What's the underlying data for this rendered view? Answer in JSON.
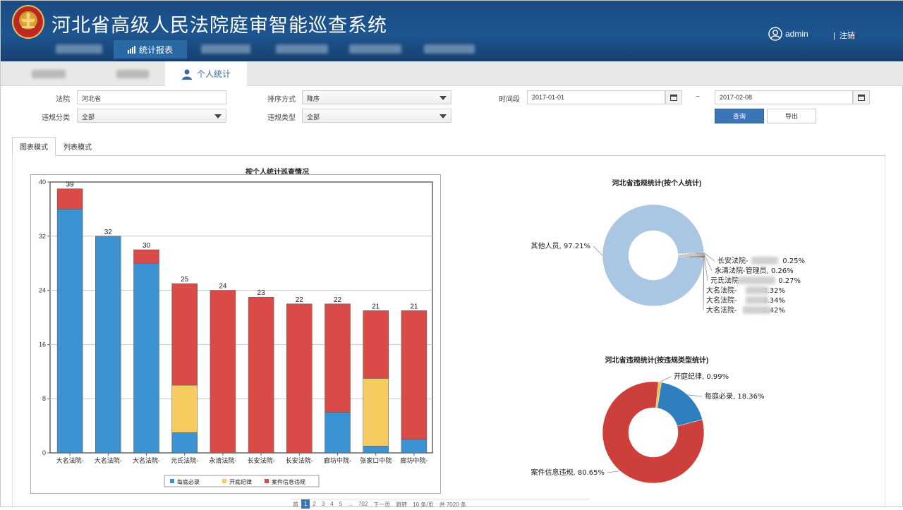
{
  "header": {
    "title": "河北省高级人民法院庭审智能巡查系统",
    "username": "admin",
    "logout_label": "注销",
    "logout_sep": "|",
    "active_nav": "统计报表"
  },
  "subtabs": {
    "active": "个人统计"
  },
  "filters": {
    "court_label": "法院",
    "court_value": "河北省",
    "sort_label": "排序方式",
    "sort_value": "降序",
    "period_label": "时间段",
    "date_from": "2017-01-01",
    "date_sep": "~",
    "date_to": "2017-02-08",
    "violation_cat_label": "违规分类",
    "violation_cat_value": "全部",
    "violation_type_label": "违规类型",
    "violation_type_value": "全部",
    "query_label": "查询",
    "export_label": "导出"
  },
  "view_tabs": {
    "chart": "图表模式",
    "list": "列表模式"
  },
  "chart_data": [
    {
      "type": "bar",
      "title": "按个人统计巡查情况",
      "categories": [
        "大名法院-",
        "大名法院-",
        "大名法院-",
        "元氏法院-",
        "永清法院-",
        "长安法院-",
        "长安法院-",
        "廊坊中院-",
        "张家口中院",
        "廊坊中院-"
      ],
      "series": [
        {
          "name": "每庭必录",
          "color": "#3d92d1",
          "values": [
            36,
            32,
            28,
            3,
            0,
            0,
            0,
            6,
            1,
            2
          ]
        },
        {
          "name": "开庭纪律",
          "color": "#f6cb5f",
          "values": [
            0,
            0,
            0,
            7,
            0,
            0,
            0,
            0,
            10,
            0
          ]
        },
        {
          "name": "案件信息违规",
          "color": "#da4b47",
          "values": [
            3,
            0,
            2,
            15,
            24,
            23,
            22,
            16,
            10,
            19
          ]
        }
      ],
      "totals": [
        39,
        32,
        30,
        25,
        24,
        23,
        22,
        22,
        21,
        21
      ],
      "ylim": [
        0,
        40
      ],
      "yticks": [
        0,
        8,
        16,
        24,
        32,
        40
      ],
      "stacked": true,
      "grid": true,
      "legend": "bottom"
    },
    {
      "type": "pie",
      "title": "河北省违规统计(按个人统计)",
      "labels": [
        "其他人员",
        "长安法院-",
        "永清法院-管理员",
        "元氏法院-",
        "大名法院-",
        "大名法院-",
        "大名法院-"
      ],
      "values": [
        97.21,
        0.25,
        0.26,
        0.27,
        0.32,
        0.34,
        0.42
      ],
      "label_texts": [
        "其他人员, 97.21%",
        "长安法院-",
        "0.25%",
        "永清法院-管理员, 0.26%",
        "元氏法院-",
        "0.27%",
        "大名法院-",
        "0.32%",
        "大名法院-",
        "0.34%",
        "大名法院-",
        "0.42%"
      ],
      "colors": [
        "#a9c6e2",
        "#555555",
        "#b54a45",
        "#6e6e6e",
        "#4a6b8a",
        "#8a5a5a",
        "#7a7a7a"
      ],
      "donut": true
    },
    {
      "type": "pie",
      "title": "河北省违规统计(按违规类型统计)",
      "labels": [
        "开庭纪律",
        "每庭必录",
        "案件信息违规"
      ],
      "values": [
        0.99,
        18.36,
        80.65
      ],
      "label_texts": [
        "开庭纪律, 0.99%",
        "每庭必录, 18.36%",
        "案件信息违规, 80.65%"
      ],
      "colors": [
        "#f0c348",
        "#2f7fbf",
        "#cc3f3b"
      ],
      "donut": true
    }
  ],
  "pager": {
    "first": "首",
    "page1": "1",
    "page2": "2",
    "page3": "3",
    "page4": "4",
    "page5": "5",
    "ellipsis": "...",
    "last_page": "702",
    "next": "下一页",
    "jump": "跳转",
    "per_page": "10 条/页",
    "total": "共 7020 条"
  },
  "colors": {
    "header_bg": "#1d5590",
    "primary": "#3c75b6"
  },
  "icons": {
    "user": "user-icon",
    "chart": "bar-chart-icon",
    "calendar": "calendar-icon",
    "person": "person-icon"
  }
}
